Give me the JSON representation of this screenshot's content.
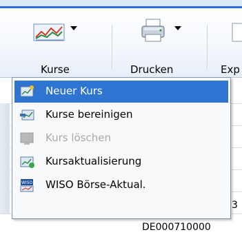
{
  "toolbar": {
    "kurse_label": "Kurse",
    "drucken_label": "Drucken",
    "export_label": "Exp"
  },
  "menu": {
    "items": [
      {
        "label": "Neuer Kurs",
        "icon": "new-quote-icon",
        "state": "selected"
      },
      {
        "label": "Kurse bereinigen",
        "icon": "clean-quotes-icon",
        "state": "normal"
      },
      {
        "label": "Kurs löschen",
        "icon": "delete-quote-icon",
        "state": "disabled"
      },
      {
        "label": "Kursaktualisierung",
        "icon": "update-quotes-icon",
        "state": "normal"
      },
      {
        "label": "WISO Börse-Aktual.",
        "icon": "wiso-icon",
        "state": "normal"
      }
    ]
  },
  "list": {
    "partial_digit": "3",
    "isin_value": "DE000710000"
  },
  "colors": {
    "accent": "#2f74d0",
    "disabled_text": "#a9a9a9"
  }
}
